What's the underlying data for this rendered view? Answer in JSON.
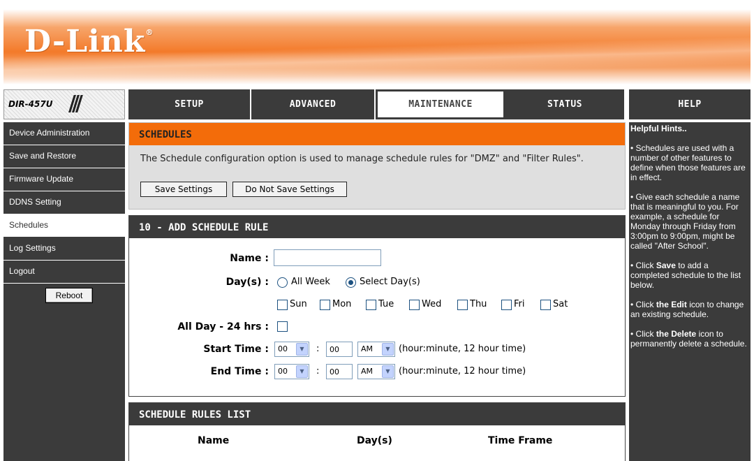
{
  "brand": {
    "logo": "D-Link",
    "reg": "®"
  },
  "model": {
    "name": "DIR-457U",
    "slashes": "///"
  },
  "tabs": [
    {
      "label": "SETUP"
    },
    {
      "label": "ADVANCED"
    },
    {
      "label": "MAINTENANCE"
    },
    {
      "label": "STATUS"
    },
    {
      "label": "HELP"
    }
  ],
  "sidebar": {
    "items": [
      {
        "label": "Device Administration"
      },
      {
        "label": "Save and Restore"
      },
      {
        "label": "Firmware Update"
      },
      {
        "label": "DDNS Setting"
      },
      {
        "label": "Schedules"
      },
      {
        "label": "Log Settings"
      },
      {
        "label": "Logout"
      }
    ],
    "reboot_label": "Reboot"
  },
  "schedules": {
    "title": "SCHEDULES",
    "description": "The Schedule configuration option is used to manage schedule rules for \"DMZ\" and \"Filter Rules\".",
    "save_label": "Save Settings",
    "dont_save_label": "Do Not Save Settings"
  },
  "add_rule": {
    "title": "10 - ADD SCHEDULE RULE",
    "name_label": "Name :",
    "name_value": "",
    "days_label": "Day(s) :",
    "all_week_label": "All Week",
    "select_days_label": "Select Day(s)",
    "days": [
      "Sun",
      "Mon",
      "Tue",
      "Wed",
      "Thu",
      "Fri",
      "Sat"
    ],
    "all_day_label": "All Day - 24 hrs :",
    "start_label": "Start Time :",
    "end_label": "End Time :",
    "start_hour": "00",
    "start_minute": "00",
    "start_ampm": "AM",
    "end_hour": "00",
    "end_minute": "00",
    "end_ampm": "AM",
    "colon": ":",
    "time_hint": "(hour:minute, 12 hour time)"
  },
  "rules_list": {
    "title": "SCHEDULE RULES LIST",
    "columns": [
      "Name",
      "Day(s)",
      "Time Frame"
    ]
  },
  "help": {
    "title": "Helpful Hints..",
    "hints": [
      "• Schedules are used with a number of other features to define when those features are in effect.",
      "• Give each schedule a name that is meaningful to you. For example, a schedule for Monday through Friday from 3:00pm to 9:00pm, might be called \"After School\"."
    ],
    "hint3_pre": "• Click ",
    "hint3_bold": "Save",
    "hint3_post": " to add a completed schedule to the list below.",
    "hint4_pre": "• Click ",
    "hint4_bold": "the Edit",
    "hint4_post": " icon to change an existing schedule.",
    "hint5_pre": "• Click ",
    "hint5_bold": "the Delete",
    "hint5_post": " icon to permanently delete a schedule."
  },
  "colors": {
    "orange": "#f36c0a",
    "dark": "#3b3b3b",
    "input_border": "#7f9db9"
  }
}
